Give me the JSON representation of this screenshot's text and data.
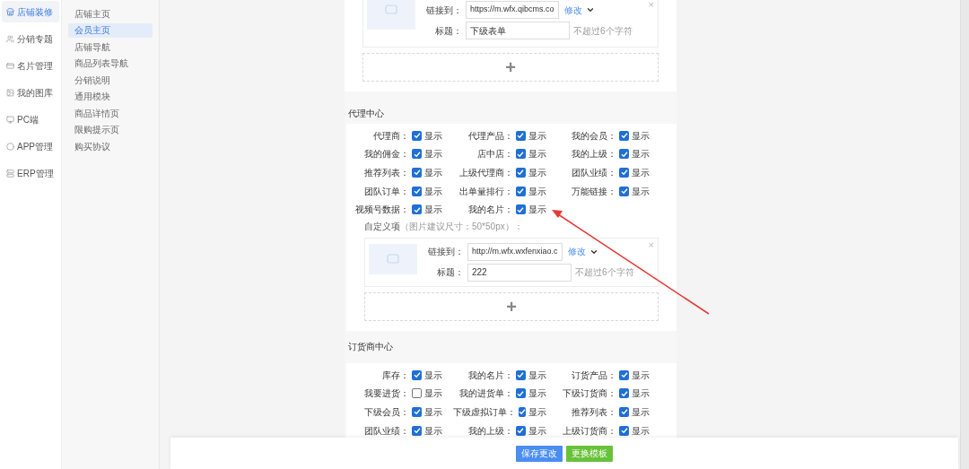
{
  "sidebar": {
    "items": [
      {
        "label": "店铺装修",
        "selected": true
      },
      {
        "label": "分销专题",
        "selected": false
      },
      {
        "label": "名片管理",
        "selected": false
      },
      {
        "label": "我的图库",
        "selected": false
      },
      {
        "label": "PC端",
        "selected": false
      },
      {
        "label": "APP管理",
        "selected": false
      },
      {
        "label": "ERP管理",
        "selected": false
      }
    ]
  },
  "subnav": {
    "items": [
      {
        "label": "店铺主页",
        "selected": false
      },
      {
        "label": "会员主页",
        "selected": true
      },
      {
        "label": "店铺导航",
        "selected": false
      },
      {
        "label": "商品列表导航",
        "selected": false
      },
      {
        "label": "分销说明",
        "selected": false
      },
      {
        "label": "通用模块",
        "selected": false
      },
      {
        "label": "商品详情页",
        "selected": false
      },
      {
        "label": "限购提示页",
        "selected": false
      },
      {
        "label": "购买协议",
        "selected": false
      }
    ]
  },
  "top_card": {
    "close": "×",
    "link_label": "链接到：",
    "link_value": "https://m.wfx.qibcms.co",
    "edit": "修改",
    "title_label": "标题：",
    "title_value": "下级表单",
    "hint": "不超过6个字符",
    "add": "+"
  },
  "sections": [
    {
      "title": "代理中心",
      "options": [
        {
          "label": "代理商：",
          "checked": true,
          "text": "显示"
        },
        {
          "label": "代理产品：",
          "checked": true,
          "text": "显示"
        },
        {
          "label": "我的会员：",
          "checked": true,
          "text": "显示"
        },
        {
          "label": "我的佣金：",
          "checked": true,
          "text": "显示"
        },
        {
          "label": "店中店：",
          "checked": true,
          "text": "显示"
        },
        {
          "label": "我的上级：",
          "checked": true,
          "text": "显示"
        },
        {
          "label": "推荐列表：",
          "checked": true,
          "text": "显示"
        },
        {
          "label": "上级代理商：",
          "checked": true,
          "text": "显示"
        },
        {
          "label": "团队业绩：",
          "checked": true,
          "text": "显示"
        },
        {
          "label": "团队订单：",
          "checked": true,
          "text": "显示"
        },
        {
          "label": "出单量排行：",
          "checked": true,
          "text": "显示"
        },
        {
          "label": "万能链接：",
          "checked": true,
          "text": "显示"
        },
        {
          "label": "视频号数据：",
          "checked": true,
          "text": "显示"
        },
        {
          "label": "我的名片：",
          "checked": true,
          "text": "显示"
        }
      ],
      "custom": {
        "label": "自定义项",
        "hint": "（图片建议尺寸：50*50px）：",
        "card": {
          "close": "×",
          "link_label": "链接到：",
          "link_value": "http://m.wfx.wxfenxiao.c",
          "edit": "修改",
          "title_label": "标题：",
          "title_value": "222",
          "hint": "不超过6个字符",
          "add": "+"
        }
      }
    },
    {
      "title": "订货商中心",
      "options": [
        {
          "label": "库存：",
          "checked": true,
          "text": "显示"
        },
        {
          "label": "我的名片：",
          "checked": true,
          "text": "显示"
        },
        {
          "label": "订货产品：",
          "checked": true,
          "text": "显示"
        },
        {
          "label": "我要进货：",
          "checked": false,
          "text": "显示"
        },
        {
          "label": "我的进货单：",
          "checked": true,
          "text": "显示"
        },
        {
          "label": "下级订货商：",
          "checked": true,
          "text": "显示"
        },
        {
          "label": "下级会员：",
          "checked": true,
          "text": "显示"
        },
        {
          "label": "下级虚拟订单：",
          "checked": true,
          "text": "显示"
        },
        {
          "label": "推荐列表：",
          "checked": true,
          "text": "显示"
        },
        {
          "label": "团队业绩：",
          "checked": true,
          "text": "显示"
        },
        {
          "label": "我的上级：",
          "checked": true,
          "text": "显示"
        },
        {
          "label": "上级订货商：",
          "checked": true,
          "text": "显示"
        }
      ]
    }
  ],
  "footer": {
    "buttons": [
      {
        "label": "保存更改",
        "kind": "primary"
      },
      {
        "label": "更换模板",
        "kind": "success"
      }
    ]
  }
}
